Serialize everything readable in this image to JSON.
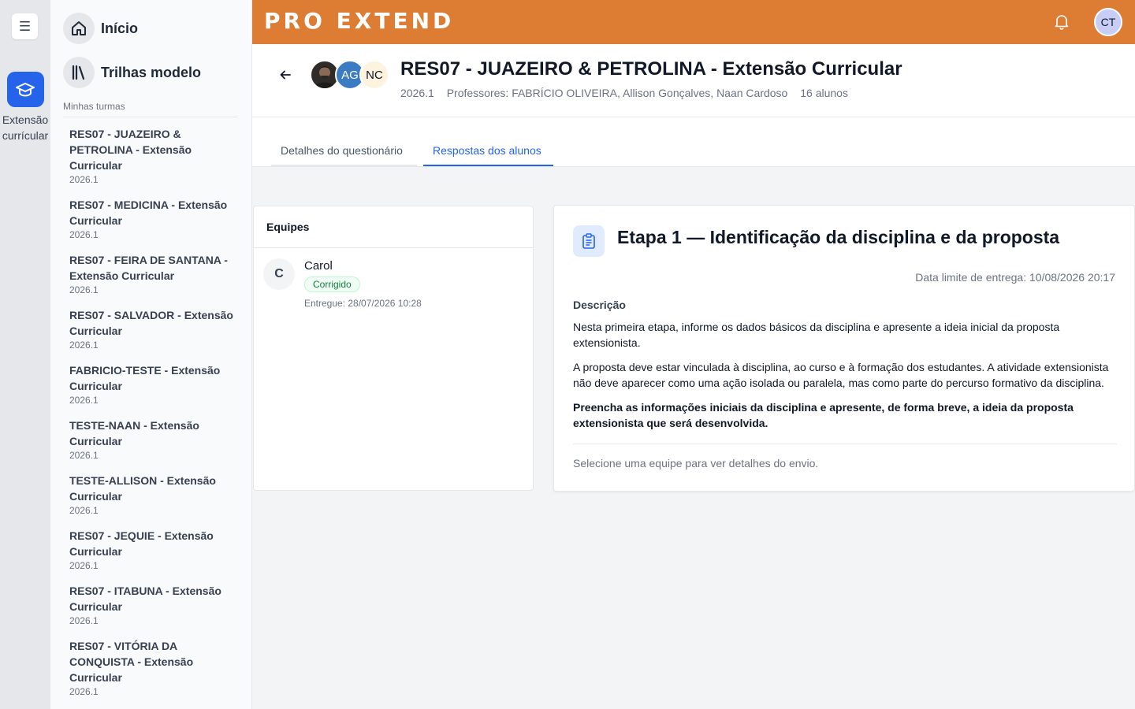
{
  "rail": {
    "menu_icon": "menu-icon",
    "item_label": "Extensão currícular",
    "item_icon": "graduation-cap-icon"
  },
  "sidebar": {
    "nav": [
      {
        "label": "Início",
        "icon": "home-icon"
      },
      {
        "label": "Trilhas modelo",
        "icon": "library-icon"
      }
    ],
    "section_label": "Minhas turmas",
    "courses": [
      {
        "name": "RES07 - JUAZEIRO & PETROLINA - Extensão Curricular",
        "term": "2026.1"
      },
      {
        "name": "RES07 - MEDICINA - Extensão Curricular",
        "term": "2026.1"
      },
      {
        "name": "RES07 - FEIRA DE SANTANA - Extensão Curricular",
        "term": "2026.1"
      },
      {
        "name": "RES07 - SALVADOR - Extensão Curricular",
        "term": "2026.1"
      },
      {
        "name": "FABRICIO-TESTE - Extensão Curricular",
        "term": "2026.1"
      },
      {
        "name": "TESTE-NAAN - Extensão Curricular",
        "term": "2026.1"
      },
      {
        "name": "TESTE-ALLISON - Extensão Curricular",
        "term": "2026.1"
      },
      {
        "name": "RES07 - JEQUIE - Extensão Curricular",
        "term": "2026.1"
      },
      {
        "name": "RES07 - ITABUNA - Extensão Curricular",
        "term": "2026.1"
      },
      {
        "name": "RES07 - VITÓRIA DA CONQUISTA - Extensão Curricular",
        "term": "2026.1"
      }
    ]
  },
  "topbar": {
    "logo": "PRO EXTEND",
    "bell_icon": "bell-icon",
    "user_initials": "CT",
    "brand_color": "#dd7d34"
  },
  "header": {
    "title": "RES07 - JUAZEIRO & PETROLINA - Extensão Curricular",
    "term": "2026.1",
    "professors": "Professores: FABRÍCIO OLIVEIRA, Allison Gonçalves, Naan Cardoso",
    "students": "16 alunos",
    "avatars": [
      "",
      "AG",
      "NC"
    ]
  },
  "tabs": [
    {
      "label": "Detalhes do questionário",
      "active": false
    },
    {
      "label": "Respostas dos alunos",
      "active": true
    }
  ],
  "teams": {
    "heading": "Equipes",
    "items": [
      {
        "initial": "C",
        "name": "Carol",
        "status": "Corrigido",
        "delivered": "Entregue: 28/07/2026 10:28"
      }
    ]
  },
  "stage": {
    "icon": "clipboard-icon",
    "title": "Etapa 1 — Identificação da disciplina e da proposta",
    "deadline": "Data limite de entrega: 10/08/2026 20:17",
    "description_label": "Descrição",
    "paragraphs": [
      "Nesta primeira etapa, informe os dados básicos da disciplina e apresente a ideia inicial da proposta extensionista.",
      "A proposta deve estar vinculada à disciplina, ao curso e à formação dos estudantes. A atividade extensionista não deve aparecer como uma ação isolada ou paralela, mas como parte do percurso formativo da disciplina.",
      "Preencha as informações iniciais da disciplina e apresente, de forma breve, a ideia da proposta extensionista que será desenvolvida."
    ],
    "select_hint": "Selecione uma equipe para ver detalhes do envio."
  }
}
